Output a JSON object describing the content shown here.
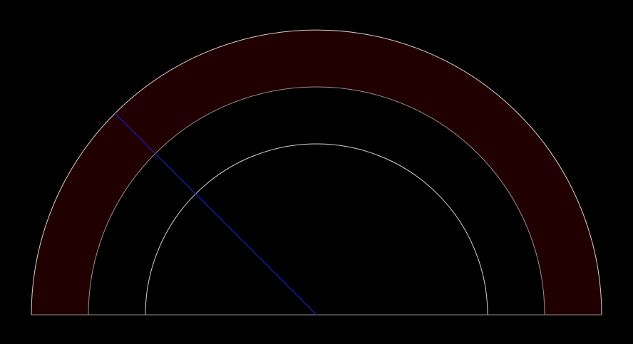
{
  "colors": {
    "background": "#000000",
    "band_fill": "#200000",
    "arc_stroke": "#d8d0cc",
    "baseline_stroke": "#9a8f8c",
    "indicator_stroke": "#1a1aa0"
  },
  "gauge": {
    "band_rings": [
      "outer-band-edge",
      "inner-band-edge"
    ],
    "has_inner_arc": true,
    "indicator_angle_deg": 135
  }
}
